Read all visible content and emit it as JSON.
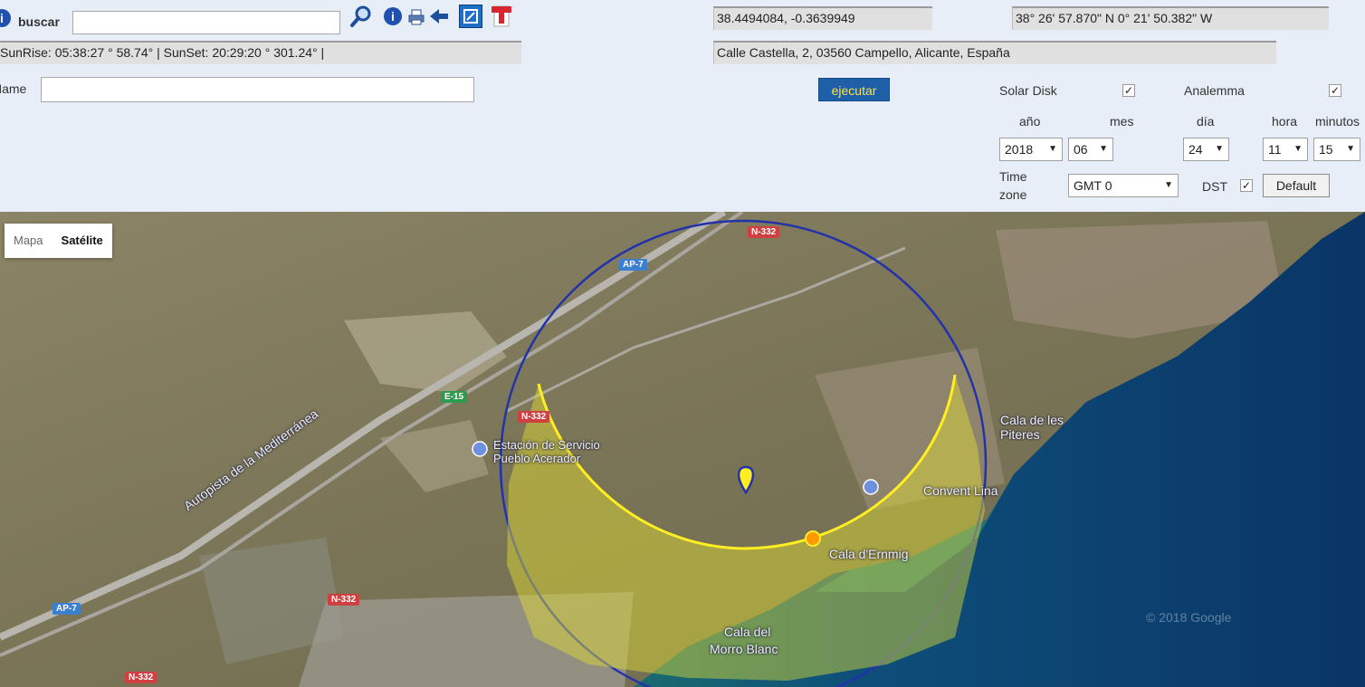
{
  "search": {
    "label": "buscar",
    "value": ""
  },
  "sun_info": "SunRise: 05:38:27 ° 58.74° | SunSet: 20:29:20 ° 301.24° |",
  "name_field": {
    "label": "Name",
    "value": ""
  },
  "coords_decimal": "38.4494084, -0.3639949",
  "coords_dms": "38° 26' 57.870\" N     0° 21' 50.382\" W",
  "address": "Calle Castella, 2, 03560 Campello, Alicante, España",
  "run_button": "ejecutar",
  "solar_disk": {
    "label": "Solar Disk",
    "checked": true
  },
  "analemma": {
    "label": "Analemma",
    "checked": true
  },
  "date_headers": {
    "year": "año",
    "month": "mes",
    "day": "día",
    "hour": "hora",
    "minutes": "minutos"
  },
  "date_values": {
    "year": "2018",
    "month": "06",
    "day": "24",
    "hour": "11",
    "minutes": "15"
  },
  "timezone": {
    "label_line1": "Time",
    "label_line2": "zone",
    "value": "GMT 0"
  },
  "dst": {
    "label": "DST",
    "checked": true
  },
  "default_button": "Default",
  "map": {
    "type_buttons": [
      "Mapa",
      "Satélite"
    ],
    "active_type": "Satélite",
    "road_labels": [
      "N-332",
      "AP-7",
      "E-15",
      "N-332",
      "N-332",
      "AP-7",
      "N-332"
    ],
    "place_labels": [
      "Estación de Servicio Pueblo Acerador",
      "Autopista de la Mediterránea",
      "Cala de les Piteres",
      "Cala d'Ernmig",
      "Cala del",
      "Morro Blanc",
      "Convent Lina"
    ],
    "copyright": "© 2018 Google",
    "colors": {
      "sea": "#0e3f6e",
      "land": "#7d7a5e",
      "circle": "#2233aa",
      "sun_path": "#ffee22",
      "sun_marker": "#ff9900"
    }
  }
}
